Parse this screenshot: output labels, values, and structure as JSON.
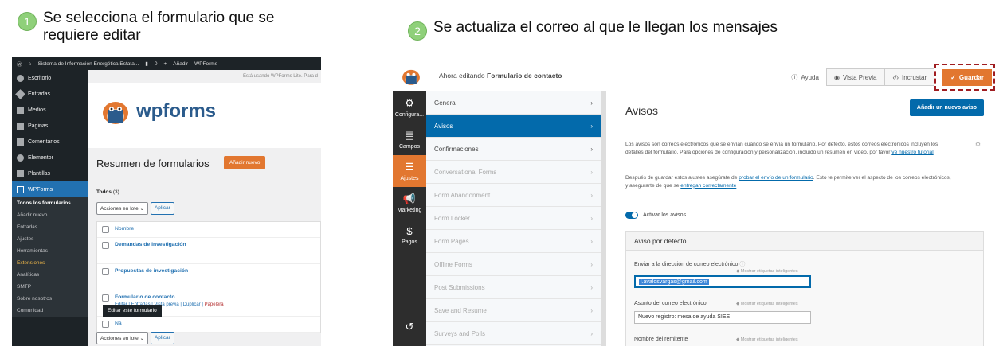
{
  "step1": {
    "number": "1",
    "text": "Se selecciona el formulario que se requiere editar"
  },
  "step2": {
    "number": "2",
    "text": "Se actualiza el correo al que le llegan los mensajes"
  },
  "panel1": {
    "adminbar": {
      "site": "Sistema de Información Energética Estata...",
      "comments": "0",
      "add": "Añadir",
      "plugin": "WPForms"
    },
    "sidebar": {
      "items": [
        "Escritorio",
        "Entradas",
        "Medios",
        "Páginas",
        "Comentarios",
        "Elementor",
        "Plantillas"
      ],
      "active": "WPForms",
      "subitems": [
        "Todos los formularios",
        "Añadir nuevo",
        "Entradas",
        "Ajustes",
        "Herramientas",
        "Extensiones",
        "Analíticas",
        "SMTP",
        "Sobre nosotros",
        "Comunidad"
      ]
    },
    "notice": "Está usando WPForms Lite. Para d",
    "logo_text": "wpforms",
    "heading": "Resumen de formularios",
    "add_new": "Añadir nuevo",
    "todos": "Todos",
    "todos_count": "(3)",
    "bulk_select": "Acciones en lote",
    "apply": "Aplicar",
    "column_name": "Nombre",
    "forms": [
      "Demandas de investigación",
      "Propuestas de investigación",
      "Formulario de contacto"
    ],
    "row_actions": {
      "edit": "Editar",
      "entries": "Entradas",
      "preview": "Vista previa",
      "duplicate": "Duplicar",
      "trash": "Papelera"
    },
    "footer_name": "Na",
    "tooltip": "Editar este formulario"
  },
  "panel2": {
    "editing_prefix": "Ahora editando",
    "form_name": "Formulario de contacto",
    "help": "Ayuda",
    "preview": "Vista Previa",
    "embed": "Incrustar",
    "save": "Guardar",
    "leftbar": [
      "Configura...",
      "Campos",
      "Ajustes",
      "Marketing",
      "Pagos"
    ],
    "sections": [
      "General",
      "Avisos",
      "Confirmaciones",
      "Conversational Forms",
      "Form Abandonment",
      "Form Locker",
      "Form Pages",
      "Offline Forms",
      "Post Submissions",
      "Save and Resume",
      "Surveys and Polls"
    ],
    "title": "Avisos",
    "add_notice": "Añadir un nuevo aviso",
    "para1_a": "Los avisos son correos electrónicos que se envían cuando se envía un formulario. Por defecto, estos correos electrónicos incluyen los detalles del formulario. Para opciones de configuración y personalización, incluido un resumen en video, por favor ",
    "para1_link": "ve nuestro tutorial",
    "para2_a": "Después de guardar estos ajustes asegúrate de ",
    "para2_link1": "probar el envío de un formulario",
    "para2_b": ". Esto te permite ver el aspecto de los correos electrónicos, y asegurarte de que se ",
    "para2_link2": "entregan correctamente",
    "toggle_label": "Activar los avisos",
    "box_title": "Aviso por defecto",
    "send_to_label": "Enviar a la dirección de correo electrónico",
    "smart_tags": "Mostrar etiquetas inteligentes",
    "email_value": "l.avalosvargas@gmail.com",
    "subject_label": "Asunto del correo electrónico",
    "subject_value": "Nuevo registro: mesa de ayuda SIEE",
    "sender_label": "Nombre del remitente"
  }
}
